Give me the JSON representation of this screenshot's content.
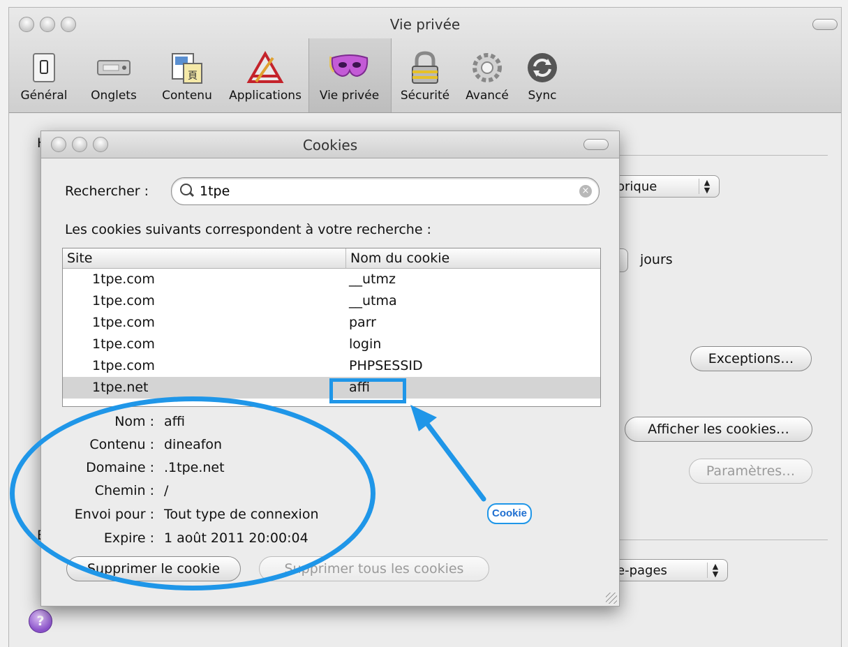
{
  "main_window": {
    "title": "Vie privée",
    "toolbar": [
      {
        "label": "Général",
        "icon": "general-switch-icon"
      },
      {
        "label": "Onglets",
        "icon": "tabs-icon"
      },
      {
        "label": "Contenu",
        "icon": "content-icon"
      },
      {
        "label": "Applications",
        "icon": "applications-icon"
      },
      {
        "label": "Vie privée",
        "icon": "privacy-mask-icon",
        "selected": true
      },
      {
        "label": "Sécurité",
        "icon": "padlock-icon"
      },
      {
        "label": "Avancé",
        "icon": "gear-icon"
      },
      {
        "label": "Sync",
        "icon": "sync-icon"
      }
    ],
    "background": {
      "history_popup_partial": "orique",
      "days_label": "jours",
      "exceptions_button": "Exceptions…",
      "show_cookies_button": "Afficher les cookies…",
      "settings_button": "Paramètres…",
      "pages_popup_partial": "e-pages",
      "left_letter_top": "H",
      "left_letter_bottom": "B"
    }
  },
  "cookies_dialog": {
    "title": "Cookies",
    "search_label": "Rechercher :",
    "search_value": "1tpe",
    "results_label": "Les cookies suivants correspondent à votre recherche :",
    "columns": {
      "site": "Site",
      "cookie_name": "Nom du cookie"
    },
    "rows": [
      {
        "site": "1tpe.com",
        "name": "__utmz"
      },
      {
        "site": "1tpe.com",
        "name": "__utma"
      },
      {
        "site": "1tpe.com",
        "name": "parr"
      },
      {
        "site": "1tpe.com",
        "name": "login"
      },
      {
        "site": "1tpe.com",
        "name": "PHPSESSID"
      },
      {
        "site": "1tpe.net",
        "name": "affi",
        "selected": true
      }
    ],
    "details": [
      {
        "label": "Nom :",
        "value": "affi"
      },
      {
        "label": "Contenu :",
        "value": "dineafon"
      },
      {
        "label": "Domaine :",
        "value": ".1tpe.net"
      },
      {
        "label": "Chemin :",
        "value": "/"
      },
      {
        "label": "Envoi pour :",
        "value": "Tout type de connexion"
      },
      {
        "label": "Expire :",
        "value": "1 août 2011 20:00:04"
      }
    ],
    "delete_button": "Supprimer le cookie",
    "delete_all_button": "Supprimer tous les cookies"
  },
  "annotation": {
    "label": "Cookie",
    "color": "#1f96e8"
  },
  "help_label": "?"
}
